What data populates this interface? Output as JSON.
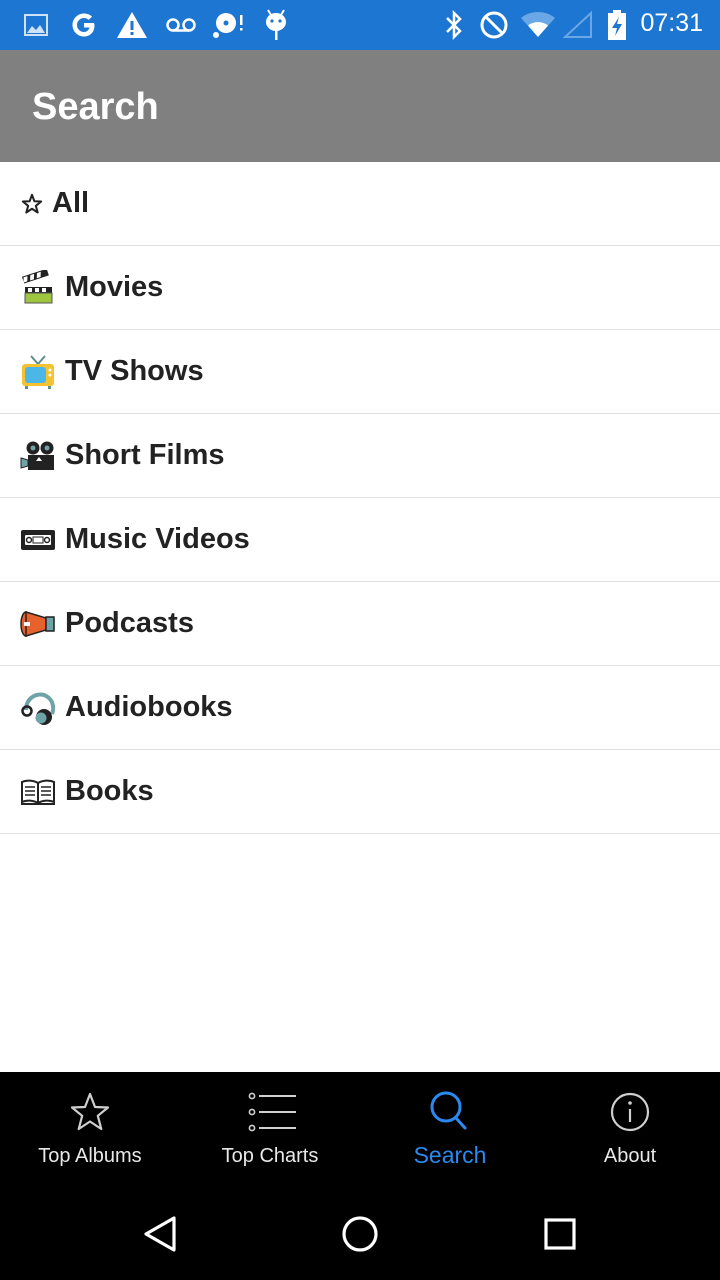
{
  "status_bar": {
    "time": "07:31",
    "left_icons": [
      "image-icon",
      "google-icon",
      "warning-icon",
      "voicemail-icon",
      "disc-alert-icon",
      "android-debug-icon"
    ],
    "right_icons": [
      "bluetooth-icon",
      "do-not-disturb-icon",
      "wifi-icon",
      "cell-signal-icon",
      "battery-charging-icon"
    ],
    "color": "#1d76d2"
  },
  "app_bar": {
    "title": "Search",
    "color": "#808080"
  },
  "categories": [
    {
      "label": "All",
      "icon": "star-icon"
    },
    {
      "label": "Movies",
      "icon": "clapperboard-icon"
    },
    {
      "label": "TV Shows",
      "icon": "television-icon"
    },
    {
      "label": "Short Films",
      "icon": "movie-camera-icon"
    },
    {
      "label": "Music Videos",
      "icon": "videocassette-icon"
    },
    {
      "label": "Podcasts",
      "icon": "megaphone-icon"
    },
    {
      "label": "Audiobooks",
      "icon": "headphones-icon"
    },
    {
      "label": "Books",
      "icon": "open-book-icon"
    }
  ],
  "tab_bar": {
    "active_color": "#2a8af0",
    "tabs": [
      {
        "label": "Top Albums",
        "icon": "star-outline-icon",
        "active": false
      },
      {
        "label": "Top Charts",
        "icon": "list-icon",
        "active": false
      },
      {
        "label": "Search",
        "icon": "search-icon",
        "active": true
      },
      {
        "label": "About",
        "icon": "info-icon",
        "active": false
      }
    ]
  },
  "nav_bar": {
    "buttons": [
      "back-button",
      "home-button",
      "recents-button"
    ]
  }
}
